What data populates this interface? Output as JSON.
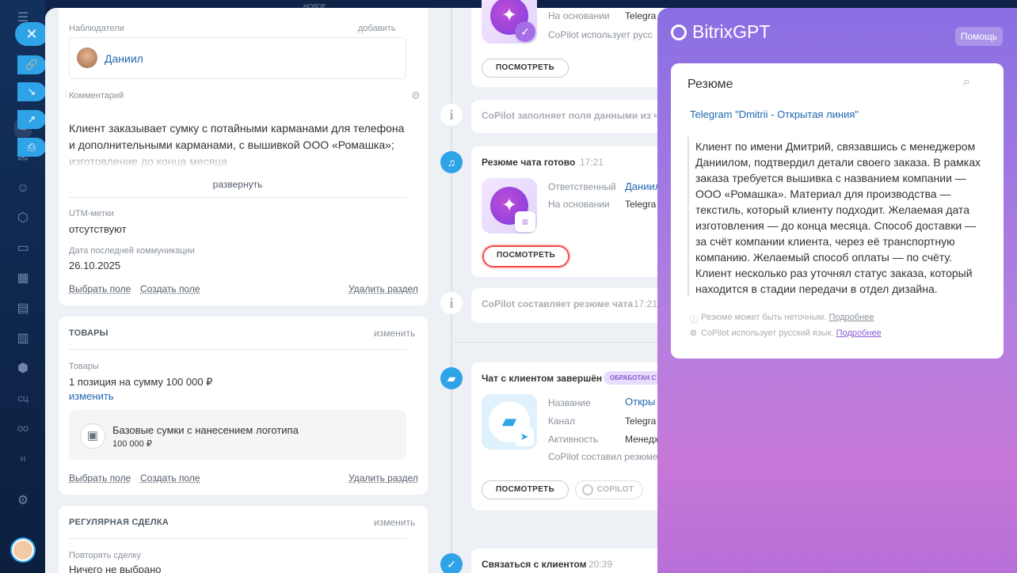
{
  "sidebar": {
    "close_label": "✕",
    "avatar_label": ""
  },
  "top_hint": "НОВОЕ",
  "observers": {
    "label": "Наблюдатели",
    "add_label": "добавить",
    "person": "Даниил"
  },
  "comment": {
    "label": "Комментарий",
    "text": "Клиент заказывает сумку с потайными карманами для телефона и дополнительными карманами, с вышивкой ООО «Ромашка»; изготовление до конца месяца",
    "expand_label": "развернуть"
  },
  "utm": {
    "label": "UTM-метки",
    "value": "отсутствуют"
  },
  "last_comm": {
    "label": "Дата последней коммуникации",
    "value": "26.10.2025"
  },
  "section_actions": {
    "choose_field": "Выбрать поле",
    "create_field": "Создать поле",
    "delete_section": "Удалить раздел"
  },
  "products": {
    "title": "ТОВАРЫ",
    "edit_label": "изменить",
    "sub_label": "Товары",
    "summary": "1 позиция на сумму 100 000 ₽",
    "change_link": "изменить",
    "item_name": "Базовые сумки с нанесением логотипа",
    "item_price": "100 000 ₽"
  },
  "regular": {
    "title": "РЕГУЛЯРНАЯ СДЕЛКА",
    "edit_label": "изменить",
    "repeat_label": "Повторять сделку",
    "repeat_value": "Ничего не выбрано"
  },
  "timeline": {
    "top_card": {
      "k1": "На основании",
      "v1": "Telegra",
      "note": "CoPilot использует русс",
      "view": "ПОСМОТРЕТЬ"
    },
    "info1": "CoPilot заполняет поля данными из чат",
    "summary_ready": {
      "title": "Резюме чата готово",
      "time": "17:21",
      "k1": "Ответственный",
      "v1": "Даниил",
      "k2": "На основании",
      "v2": "Telegra",
      "view": "ПОСМОТРЕТЬ"
    },
    "info2": {
      "text": "CoPilot составляет резюме чата",
      "time": "17:21"
    },
    "chat_done": {
      "title": "Чат с клиентом завершён",
      "badge": "ОБРАБОТАН С",
      "k1": "Название",
      "v1": "Откры",
      "k2": "Канал",
      "v2": "Telegra",
      "k3": "Активность",
      "v3": "Менедж",
      "note": "CoPilot составил резюме",
      "view": "ПОСМОТРЕТЬ",
      "copilot": "COPILOT"
    },
    "contact": {
      "title": "Связаться с клиентом",
      "time": "20:39"
    }
  },
  "gpt": {
    "title": "BitrixGPT",
    "help": "Помощь",
    "card_title": "Резюме",
    "source_link": "Telegram \"Dmitrii - Открытая линия\"",
    "summary": "Клиент по имени Дмитрий, связавшись с менеджером Даниилом, подтвердил детали своего заказа. В рамках заказа требуется вышивка с названием компании — ООО «Ромашка». Материал для производства — текстиль, который клиенту подходит. Желаемая дата изготовления — до конца месяца. Способ доставки — за счёт компании клиента, через её транспортную компанию. Желаемый способ оплаты — по счёту. Клиент несколько раз уточнял статус заказа, который находится в стадии передачи в отдел дизайна.",
    "note1": "Резюме может быть неточным.",
    "note1_link": "Подробнее",
    "note2": "CoPilot использует русский язык.",
    "note2_link": "Подробнее"
  },
  "colors": {
    "accent": "#2fa3e8",
    "highlight": "#f04848",
    "purple": "#8a6fe3"
  }
}
